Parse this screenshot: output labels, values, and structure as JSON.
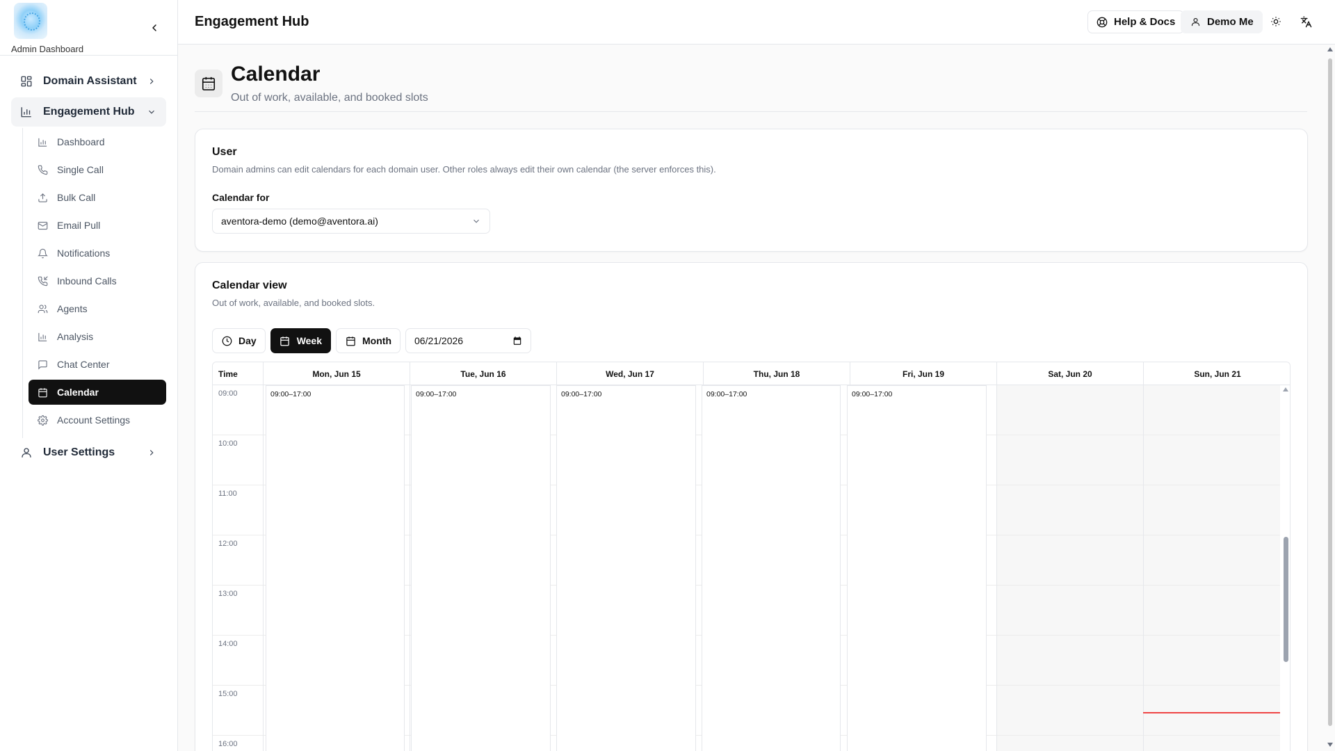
{
  "sidebar": {
    "caption": "Admin Dashboard",
    "nav": [
      {
        "label": "Domain Assistant",
        "icon": "grid-icon"
      },
      {
        "label": "Engagement Hub",
        "icon": "bar-chart-icon"
      },
      {
        "label": "User Settings",
        "icon": "user-icon"
      }
    ],
    "sub_items": [
      {
        "label": "Dashboard",
        "icon": "bar-chart-icon"
      },
      {
        "label": "Single Call",
        "icon": "phone-icon"
      },
      {
        "label": "Bulk Call",
        "icon": "upload-icon"
      },
      {
        "label": "Email Pull",
        "icon": "mail-icon"
      },
      {
        "label": "Notifications",
        "icon": "bell-icon"
      },
      {
        "label": "Inbound Calls",
        "icon": "phone-incoming-icon"
      },
      {
        "label": "Agents",
        "icon": "users-icon"
      },
      {
        "label": "Analysis",
        "icon": "bar-chart-icon"
      },
      {
        "label": "Chat Center",
        "icon": "message-square-icon"
      },
      {
        "label": "Calendar",
        "icon": "calendar-icon",
        "active": true
      },
      {
        "label": "Account Settings",
        "icon": "gear-icon"
      }
    ]
  },
  "header": {
    "title": "Engagement Hub",
    "help_label": "Help & Docs",
    "user_label": "Demo Me"
  },
  "page": {
    "title": "Calendar",
    "subtitle": "Out of work, available, and booked slots"
  },
  "user_card": {
    "title": "User",
    "description": "Domain admins can edit calendars for each domain user. Other roles always edit their own calendar (the server enforces this).",
    "field_label": "Calendar for",
    "selected": "aventora-demo (demo@aventora.ai)"
  },
  "calendar_card": {
    "title": "Calendar view",
    "description": "Out of work, available, and booked slots.",
    "views": [
      "Day",
      "Week",
      "Month"
    ],
    "active_view": "Week",
    "date": "06/21/2026",
    "time_header": "Time",
    "days": [
      "Mon, Jun 15",
      "Tue, Jun 16",
      "Wed, Jun 17",
      "Thu, Jun 18",
      "Fri, Jun 19",
      "Sat, Jun 20",
      "Sun, Jun 21"
    ],
    "times": [
      "09:00",
      "10:00",
      "11:00",
      "12:00",
      "13:00",
      "14:00",
      "15:00",
      "16:00"
    ],
    "available_slots": [
      {
        "day": "Mon, Jun 15",
        "label": "09:00–17:00"
      },
      {
        "day": "Tue, Jun 16",
        "label": "09:00–17:00"
      },
      {
        "day": "Wed, Jun 17",
        "label": "09:00–17:00"
      },
      {
        "day": "Thu, Jun 18",
        "label": "09:00–17:00"
      },
      {
        "day": "Fri, Jun 19",
        "label": "09:00–17:00"
      }
    ],
    "current_time_day": "Sun, Jun 21",
    "colors": {
      "now_line": "#ef4444",
      "active": "#111111"
    }
  }
}
